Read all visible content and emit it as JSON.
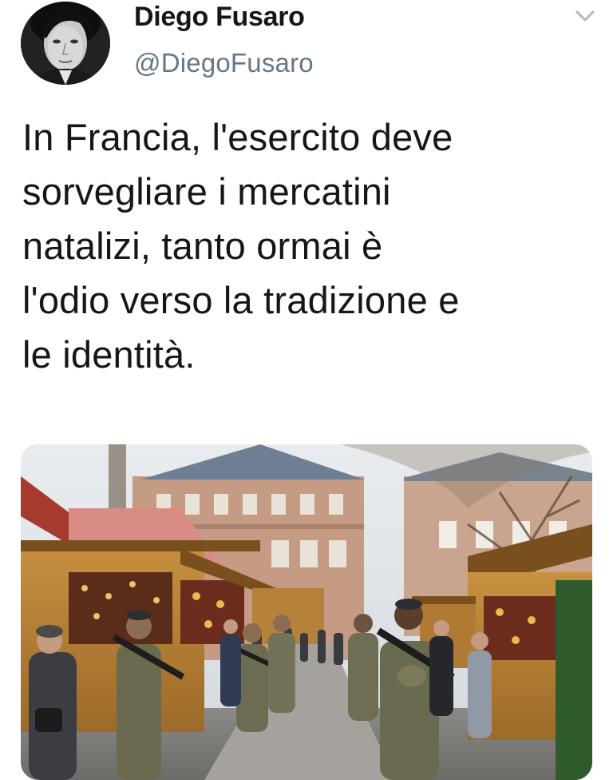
{
  "user": {
    "display_name": "Diego Fusaro",
    "handle": "@DiegoFusaro"
  },
  "tweet": {
    "text_lines": [
      "In Francia, l'esercito deve",
      "sorvegliare i mercatini",
      "natalizi, tanto ormai è",
      "l'odio verso la tradizione e",
      "le identità."
    ]
  },
  "icons": {
    "menu": "chevron-down-icon",
    "avatar": "profile-photo"
  },
  "colors": {
    "text": "#14171a",
    "secondary_text": "#657786",
    "chevron": "#aab8c2"
  }
}
